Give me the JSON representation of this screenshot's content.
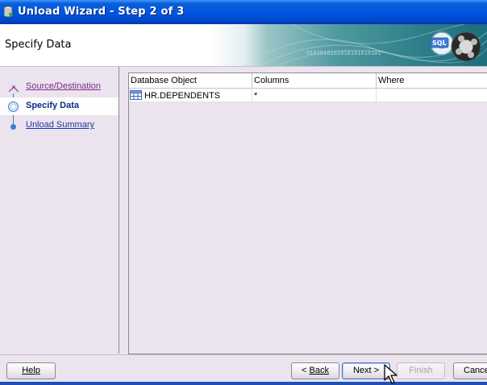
{
  "window": {
    "title": "Unload Wizard - Step 2 of 3",
    "icon": "database-wizard-icon"
  },
  "header": {
    "page_title": "Specify Data",
    "banner_text": "0101010101010101010101",
    "banner_badge": "SQL"
  },
  "steps": [
    {
      "label": "Source/Destination",
      "state": "visited"
    },
    {
      "label": "Specify Data",
      "state": "current"
    },
    {
      "label": "Unload Summary",
      "state": "pending"
    }
  ],
  "table": {
    "columns": [
      "Database Object",
      "Columns",
      "Where"
    ],
    "rows": [
      {
        "object": "HR.DEPENDENTS",
        "columns": "*",
        "where": "",
        "icon": "table-icon"
      }
    ]
  },
  "buttons": {
    "help": "Help",
    "back_prefix": "< ",
    "back": "Back",
    "next": "Next >",
    "finish": "Finish",
    "cancel": "Cancel"
  },
  "colors": {
    "titlebar": "#0055e5",
    "link": "#1c3aa3",
    "visited_link": "#7a2c8a",
    "step_accent": "#3f7dd1"
  }
}
